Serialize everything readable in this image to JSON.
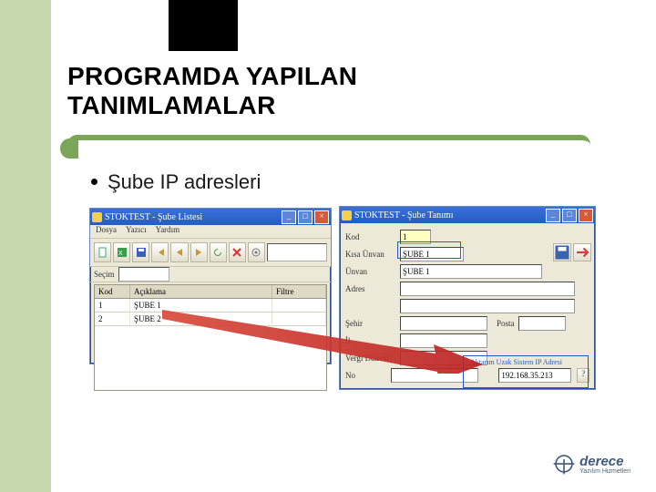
{
  "slide": {
    "title_line1": "PROGRAMDA YAPILAN",
    "title_line2": "TANIMLAMALAR",
    "bullet": "Şube IP adresleri"
  },
  "win1": {
    "title": "STOKTEST - Şube Listesi",
    "menus": {
      "m1": "Dosya",
      "m2": "Yazıcı",
      "m3": "Yardım"
    },
    "filter_label": "Seçim",
    "cols": {
      "kod": "Kod",
      "aciklama": "Açıklama",
      "filtre": "Filtre"
    },
    "rows": [
      {
        "kod": "1",
        "aciklama": "ŞUBE 1"
      },
      {
        "kod": "2",
        "aciklama": "ŞUBE 2"
      }
    ]
  },
  "win2": {
    "title": "STOKTEST - Şube Tanımı",
    "labels": {
      "kod": "Kod",
      "kisa": "Kısa Ünvan",
      "unvan": "Ünvan",
      "adres": "Adres",
      "sehir": "Şehir",
      "posta": "Posta",
      "il": "İl",
      "vd": "Vergi Dairesi",
      "no": "No",
      "ip": "Aktarım Uzak Sistem IP Adresi"
    },
    "values": {
      "kod": "1",
      "kisa": "ŞUBE 1",
      "unvan": "ŞUBE 1",
      "ip": "192.168.35.213"
    },
    "help": "?"
  },
  "wbtn": {
    "min": "_",
    "max": "□",
    "close": "×"
  },
  "logo": {
    "name": "derece",
    "sub": "Yazılım Hizmetleri"
  }
}
